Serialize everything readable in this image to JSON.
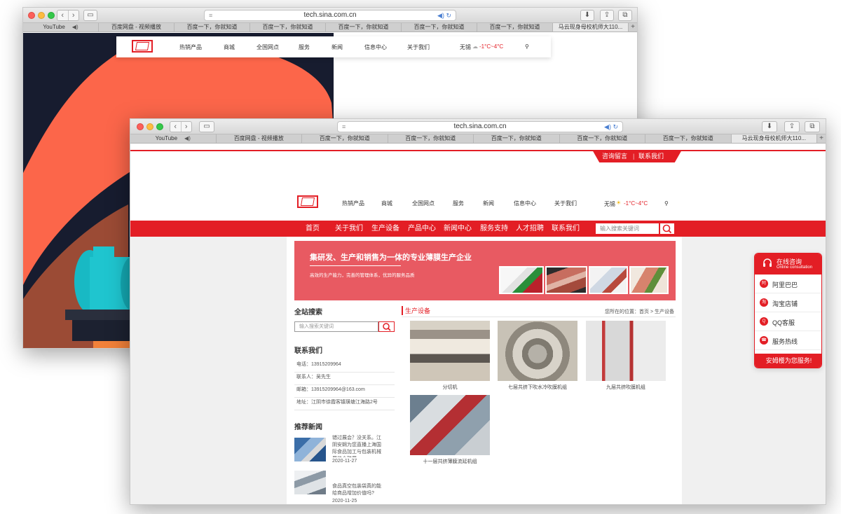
{
  "back_window": {
    "url": "tech.sina.com.cn",
    "tabs": [
      "YouTube",
      "百度网盘 - 视频播放",
      "百度一下，你就知道",
      "百度一下，你就知道",
      "百度一下，你就知道",
      "百度一下，你就知道",
      "百度一下，你就知道",
      "马云现身母校机师大110..."
    ],
    "nav": [
      "热销产品",
      "商城",
      "全国网点",
      "服务",
      "新闻",
      "信息中心",
      "关于我们"
    ],
    "weather_city": "无锡",
    "weather_temp": "-1°C~4°C"
  },
  "front_window": {
    "url": "tech.sina.com.cn",
    "tabs": [
      "YouTube",
      "百度网盘 - 视频播放",
      "百度一下，你就知道",
      "百度一下，你就知道",
      "百度一下，你就知道",
      "百度一下，你就知道",
      "百度一下，你就知道",
      "马云现身母校机师大110..."
    ],
    "top_links": [
      "咨询留言",
      "联系我们"
    ],
    "nav": [
      "热销产品",
      "商城",
      "全国网点",
      "服务",
      "新闻",
      "信息中心",
      "关于我们"
    ],
    "weather_city": "无锡",
    "weather_temp": "-1°C~4°C",
    "red_nav": [
      "首页",
      "关于我们",
      "生产设备",
      "产品中心",
      "新闻中心",
      "服务支持",
      "人才招聘",
      "联系我们"
    ],
    "red_nav_search_placeholder": "输入搜索关键词",
    "banner": {
      "title": "集研发、生产和销售为一体的专业薄膜生产企业",
      "subtitle": "高效的生产能力，完善的管理体系，优异的服务品质"
    },
    "sidebar": {
      "search_title": "全站搜索",
      "search_placeholder": "输入搜索关键词",
      "contact_title": "联系我们",
      "contact_lines": [
        "电话：13915209964",
        "联系人：吴先生",
        "邮箱：13915209964@163.com",
        "地址：江阴市徐霞客镇璜塘江海路2号"
      ],
      "news_title": "推荐新闻",
      "news": [
        {
          "title": "错过展会？没关系。江阴安娴为您直播上海国际食品加工与包装机械展览会联展",
          "date": "2020-11-27"
        },
        {
          "title": "食品真空包装袋真的能给商品增加价值吗?",
          "date": "2020-11-25"
        }
      ]
    },
    "products": {
      "section_title": "生产设备",
      "breadcrumb_prefix": "您所在的位置：",
      "breadcrumb_home": "首页",
      "breadcrumb_sep": ">",
      "breadcrumb_current": "生产设备",
      "items": [
        "分切机",
        "七层共挤下吹水冷吹膜机组",
        "九层共挤吹膜机组",
        "十一层共挤薄膜流延机组"
      ]
    },
    "service_widget": {
      "title": "在线咨询",
      "subtitle": "Online consultation",
      "items": [
        "阿里巴巴",
        "淘宝店铺",
        "QQ客服",
        "服务热线"
      ],
      "item_icons": [
        "阿",
        "淘",
        "Q",
        "☎"
      ],
      "footer": "安姆樱为您服务!"
    }
  }
}
